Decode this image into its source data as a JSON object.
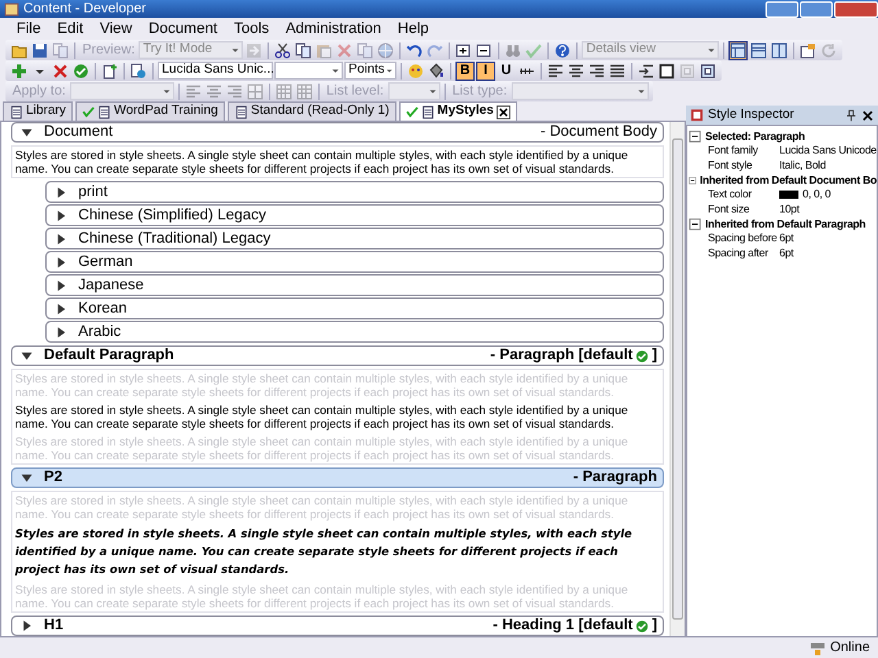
{
  "window": {
    "title": "Content - Developer"
  },
  "menu": [
    "File",
    "Edit",
    "View",
    "Document",
    "Tools",
    "Administration",
    "Help"
  ],
  "toolbars": [
    {
      "items": [
        {
          "kind": "button",
          "disabled": false
        },
        {
          "kind": "button",
          "disabled": false
        },
        {
          "kind": "button",
          "disabled": true
        },
        {
          "kind": "sep"
        },
        {
          "kind": "label",
          "text": "Preview:",
          "disabled": true
        },
        {
          "kind": "combo",
          "value": "Try It! Mode",
          "disabled": true
        },
        {
          "kind": "button",
          "disabled": true
        },
        {
          "kind": "sep"
        },
        {
          "kind": "button",
          "disabled": false
        },
        {
          "kind": "button",
          "disabled": false
        },
        {
          "kind": "button",
          "disabled": true
        },
        {
          "kind": "button",
          "disabled": true
        },
        {
          "kind": "button",
          "disabled": true
        },
        {
          "kind": "button",
          "disabled": true
        },
        {
          "kind": "sep"
        },
        {
          "kind": "button",
          "disabled": false
        },
        {
          "kind": "button",
          "disabled": true
        },
        {
          "kind": "sep"
        },
        {
          "kind": "button",
          "disabled": false
        },
        {
          "kind": "button",
          "disabled": false
        },
        {
          "kind": "sep"
        },
        {
          "kind": "button",
          "disabled": true
        },
        {
          "kind": "button",
          "disabled": true
        },
        {
          "kind": "sep"
        },
        {
          "kind": "button",
          "disabled": false
        },
        {
          "kind": "sep"
        },
        {
          "kind": "combo",
          "value": "Details view",
          "disabled": true
        },
        {
          "kind": "sep"
        },
        {
          "kind": "button",
          "disabled": false,
          "pressed": true
        },
        {
          "kind": "button",
          "disabled": false,
          "pressed": false
        },
        {
          "kind": "button",
          "disabled": false,
          "pressed": false
        },
        {
          "kind": "sep"
        },
        {
          "kind": "button",
          "disabled": false
        },
        {
          "kind": "button",
          "disabled": true
        }
      ]
    },
    {
      "items": [
        {
          "kind": "button",
          "disabled": false
        },
        {
          "kind": "button",
          "disabled": false
        },
        {
          "kind": "button",
          "disabled": false
        },
        {
          "kind": "button",
          "disabled": false
        },
        {
          "kind": "sep"
        },
        {
          "kind": "button",
          "disabled": false
        },
        {
          "kind": "sep"
        },
        {
          "kind": "button",
          "disabled": false
        },
        {
          "kind": "sep"
        },
        {
          "kind": "combo",
          "value": "Lucida Sans Unic...",
          "disabled": false
        },
        {
          "kind": "combo",
          "disabled": false
        },
        {
          "kind": "combo",
          "value": "Points",
          "disabled": false
        },
        {
          "kind": "sep"
        },
        {
          "kind": "button",
          "disabled": false
        },
        {
          "kind": "button",
          "disabled": false
        },
        {
          "kind": "sep"
        },
        {
          "kind": "button",
          "label": "B",
          "pressed": true,
          "disabled": false
        },
        {
          "kind": "button",
          "label": "I",
          "pressed": true,
          "disabled": false
        },
        {
          "kind": "button",
          "label": "U",
          "pressed": false,
          "disabled": false
        },
        {
          "kind": "button",
          "disabled": false
        },
        {
          "kind": "sep"
        },
        {
          "kind": "button",
          "disabled": false
        },
        {
          "kind": "button",
          "disabled": false
        },
        {
          "kind": "button",
          "disabled": false
        },
        {
          "kind": "button",
          "disabled": false
        },
        {
          "kind": "sep"
        },
        {
          "kind": "button",
          "disabled": false
        },
        {
          "kind": "button",
          "disabled": false
        },
        {
          "kind": "button",
          "disabled": true
        },
        {
          "kind": "button",
          "disabled": false
        }
      ]
    },
    {
      "items": [
        {
          "kind": "label",
          "text": "Apply to:",
          "disabled": true
        },
        {
          "kind": "combo",
          "disabled": true
        },
        {
          "kind": "sep"
        },
        {
          "kind": "button",
          "disabled": true
        },
        {
          "kind": "button",
          "disabled": true
        },
        {
          "kind": "button",
          "disabled": true
        },
        {
          "kind": "button",
          "disabled": true
        },
        {
          "kind": "sep"
        },
        {
          "kind": "button",
          "disabled": true
        },
        {
          "kind": "button",
          "disabled": true
        },
        {
          "kind": "sep"
        },
        {
          "kind": "label",
          "text": "List level:",
          "disabled": true
        },
        {
          "kind": "combo",
          "disabled": true
        },
        {
          "kind": "sep"
        },
        {
          "kind": "label",
          "text": "List type:",
          "disabled": true
        },
        {
          "kind": "combo",
          "disabled": true
        }
      ]
    }
  ],
  "tabs": [
    {
      "label": "Library",
      "selected": false,
      "checked": false
    },
    {
      "label": "WordPad Training",
      "selected": false,
      "checked": true
    },
    {
      "label": "Standard (Read-Only 1)",
      "selected": false,
      "checked": false
    },
    {
      "label": "MyStyles",
      "selected": true,
      "checked": true
    }
  ],
  "styles": [
    {
      "title": "Document",
      "type": "- Document Body",
      "expanded": true,
      "selected": false,
      "samples": [
        {
          "kind": "current",
          "text": "Styles are stored in style sheets. A single style sheet can contain multiple styles, with each style identified by a unique name. You can create separate style sheets for different projects if each project has its own set of visual standards."
        }
      ],
      "children": [
        {
          "title": "print",
          "expanded": false
        },
        {
          "title": "Chinese (Simplified) Legacy",
          "expanded": false
        },
        {
          "title": "Chinese (Traditional) Legacy",
          "expanded": false
        },
        {
          "title": "German",
          "expanded": false
        },
        {
          "title": "Japanese",
          "expanded": false
        },
        {
          "title": "Korean",
          "expanded": false
        },
        {
          "title": "Arabic",
          "expanded": false
        }
      ]
    },
    {
      "title": "Default Paragraph",
      "type": "- Paragraph [default",
      "default": true,
      "type_end": "]",
      "expanded": true,
      "selected": false,
      "samples": [
        {
          "kind": "other",
          "text": "Styles are stored in style sheets. A single style sheet can contain multiple styles, with each style identified by a unique name. You can create separate style sheets for different projects if each project has its own set of visual standards."
        },
        {
          "kind": "current",
          "text": "Styles are stored in style sheets. A single style sheet can contain multiple styles, with each style identified by a unique name. You can create separate style sheets for different projects if each project has its own set of visual standards."
        },
        {
          "kind": "other",
          "text": "Styles are stored in style sheets. A single style sheet can contain multiple styles, with each style identified by a unique name. You can create separate style sheets for different projects if each project has its own set of visual standards."
        }
      ]
    },
    {
      "title": "P2",
      "type": "- Paragraph",
      "expanded": true,
      "selected": true,
      "samples": [
        {
          "kind": "other",
          "text": "Styles are stored in style sheets. A single style sheet can contain multiple styles, with each style identified by a unique name. You can create separate style sheets for different projects if each project has its own set of visual standards."
        },
        {
          "kind": "emphasis",
          "text": "Styles are stored in style sheets. A single style sheet can contain multiple styles, with each style identified by a unique name. You can create separate style sheets for different projects if each project has its own set of visual standards."
        },
        {
          "kind": "other",
          "text": "Styles are stored in style sheets. A single style sheet can contain multiple styles, with each style identified by a unique name. You can create separate style sheets for different projects if each project has its own set of visual standards."
        }
      ]
    },
    {
      "title": "H1",
      "type": "- Heading 1 [default",
      "default": true,
      "type_end": "]",
      "expanded": false,
      "selected": false
    }
  ],
  "inspector": {
    "title": "Style Inspector",
    "groups": [
      {
        "title": "Selected: Paragraph",
        "expanded": true,
        "props": [
          {
            "name": "Font family",
            "value": "Lucida Sans Unicode"
          },
          {
            "name": "Font style",
            "value": "Italic, Bold"
          }
        ]
      },
      {
        "title": "Inherited from Default Document Bo",
        "expanded": true,
        "props": [
          {
            "name": "Text color",
            "value": "0, 0, 0",
            "color": "#000000"
          },
          {
            "name": "Font size",
            "value": "10pt"
          }
        ]
      },
      {
        "title": "Inherited from Default Paragraph",
        "expanded": true,
        "props": [
          {
            "name": "Spacing before",
            "value": "6pt"
          },
          {
            "name": "Spacing after",
            "value": "6pt"
          }
        ]
      }
    ]
  },
  "status_bar": {
    "text": "Online"
  }
}
